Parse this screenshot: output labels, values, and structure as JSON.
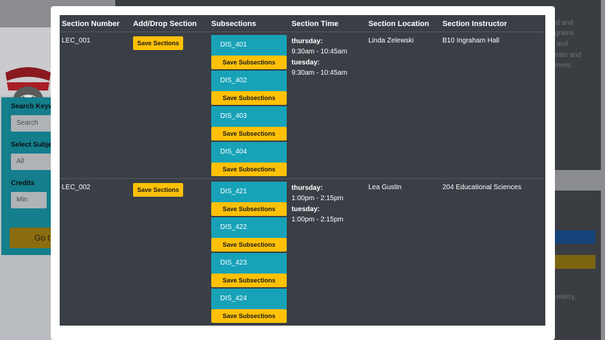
{
  "background": {
    "filter_labels": [
      "Search Keyw",
      "Select Subje",
      "Credits"
    ],
    "search_placeholder": "Search",
    "subject_value": "All",
    "credits_min": "Min",
    "go_label": "Go t",
    "right_text": [
      "sed and",
      "rograms",
      "ta and",
      "create and",
      "generic",
      "hemistry,"
    ]
  },
  "table": {
    "headers": [
      "Section Number",
      "Add/Drop Section",
      "Subsections",
      "Section Time",
      "Section Location",
      "Section Instructor"
    ],
    "save_sections_label": "Save Sections",
    "save_subsections_label": "Save Subsections",
    "rows": [
      {
        "section": "LEC_001",
        "subsections": [
          "DIS_401",
          "DIS_402",
          "DIS_403",
          "DIS_404"
        ],
        "times": [
          {
            "day": "thursday:",
            "range": "9:30am - 10:45am"
          },
          {
            "day": "tuesday:",
            "range": "9:30am - 10:45am"
          }
        ],
        "location": "Linda Zelewski",
        "instructor": "B10 Ingraham Hall"
      },
      {
        "section": "LEC_002",
        "subsections": [
          "DIS_421",
          "DIS_422",
          "DIS_423",
          "DIS_424"
        ],
        "times": [
          {
            "day": "thursday:",
            "range": "1:00pm - 2:15pm"
          },
          {
            "day": "tuesday:",
            "range": "1:00pm - 2:15pm"
          }
        ],
        "location": "Lea Gustin",
        "instructor": "204 Educational Sciences"
      }
    ]
  },
  "colors": {
    "table_bg": "#3a3f46",
    "accent_yellow": "#ffc107",
    "accent_teal": "#17a2b8"
  }
}
